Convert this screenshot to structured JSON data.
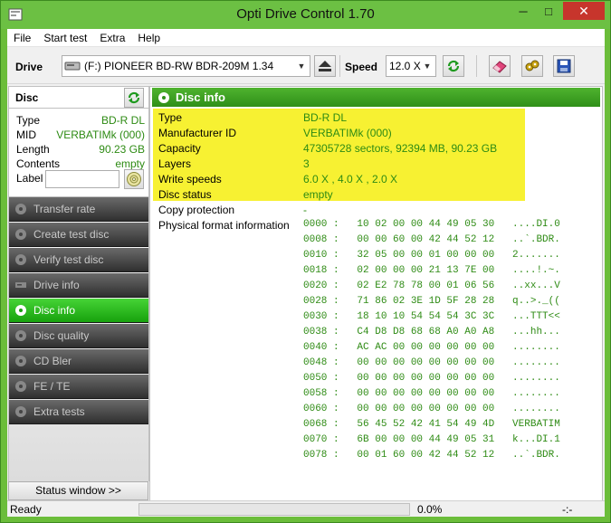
{
  "window": {
    "title": "Opti Drive Control 1.70",
    "minimize_glyph": "─",
    "maximize_glyph": "□",
    "close_glyph": "✕"
  },
  "menu": [
    "File",
    "Start test",
    "Extra",
    "Help"
  ],
  "toolbar": {
    "drive_label": "Drive",
    "drive_value": "(F:)  PIONEER BD-RW   BDR-209M 1.34",
    "speed_label": "Speed",
    "speed_value": "12.0 X"
  },
  "disc_panel": {
    "title": "Disc",
    "rows": [
      {
        "k": "Type",
        "v": "BD-R DL"
      },
      {
        "k": "MID",
        "v": "VERBATIMk (000)"
      },
      {
        "k": "Length",
        "v": "90.23 GB"
      },
      {
        "k": "Contents",
        "v": "empty"
      }
    ],
    "label_caption": "Label",
    "label_value": ""
  },
  "nav": [
    {
      "label": "Transfer rate",
      "active": false
    },
    {
      "label": "Create test disc",
      "active": false
    },
    {
      "label": "Verify test disc",
      "active": false
    },
    {
      "label": "Drive info",
      "active": false
    },
    {
      "label": "Disc info",
      "active": true
    },
    {
      "label": "Disc quality",
      "active": false
    },
    {
      "label": "CD Bler",
      "active": false
    },
    {
      "label": "FE / TE",
      "active": false
    },
    {
      "label": "Extra tests",
      "active": false
    }
  ],
  "status_window_button": "Status window >>",
  "main": {
    "title": "Disc info",
    "rows": [
      {
        "k": "Type",
        "v": "BD-R DL"
      },
      {
        "k": "Manufacturer ID",
        "v": "VERBATIMk (000)"
      },
      {
        "k": "Capacity",
        "v": "47305728 sectors, 92394 MB, 90.23 GB"
      },
      {
        "k": "Layers",
        "v": "3"
      },
      {
        "k": "Write speeds",
        "v": "6.0 X , 4.0 X , 2.0 X"
      },
      {
        "k": "Disc status",
        "v": "empty"
      },
      {
        "k": "Copy protection",
        "v": "-"
      },
      {
        "k": "Physical format information",
        "v": ""
      }
    ],
    "hex": [
      "0000 :   10 02 00 00 44 49 05 30   ....DI.0",
      "0008 :   00 00 60 00 42 44 52 12   ..`.BDR.",
      "0010 :   32 05 00 00 01 00 00 00   2.......",
      "0018 :   02 00 00 00 21 13 7E 00   ....!.~.",
      "0020 :   02 E2 78 78 00 01 06 56   ..xx...V",
      "0028 :   71 86 02 3E 1D 5F 28 28   q..>._((",
      "0030 :   18 10 10 54 54 54 3C 3C   ...TTT<<",
      "0038 :   C4 D8 D8 68 68 A0 A0 A8   ...hh...",
      "0040 :   AC AC 00 00 00 00 00 00   ........",
      "0048 :   00 00 00 00 00 00 00 00   ........",
      "0050 :   00 00 00 00 00 00 00 00   ........",
      "0058 :   00 00 00 00 00 00 00 00   ........",
      "0060 :   00 00 00 00 00 00 00 00   ........",
      "0068 :   56 45 52 42 41 54 49 4D   VERBATIM",
      "0070 :   6B 00 00 00 44 49 05 31   k...DI.1",
      "0078 :   00 01 60 00 42 44 52 12   ..`.BDR."
    ]
  },
  "statusbar": {
    "status": "Ready",
    "progress_percent": 0,
    "progress_text": "0.0%",
    "time": "-:-"
  },
  "colors": {
    "accent_green": "#2e8b14",
    "highlight_yellow": "#f7f132",
    "active_nav": "#17a10d",
    "close_red": "#c7352c"
  }
}
